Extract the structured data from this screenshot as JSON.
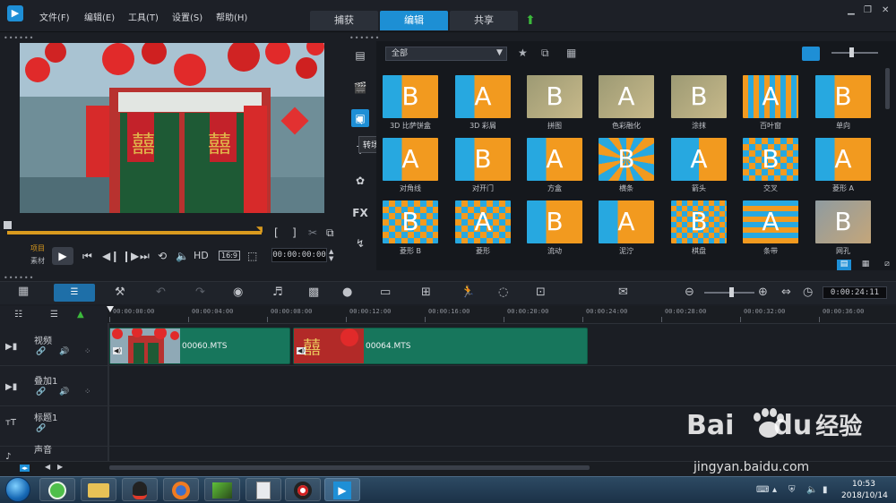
{
  "menu": {
    "file": "文件(F)",
    "edit": "编辑(E)",
    "tools": "工具(T)",
    "settings": "设置(S)",
    "help": "帮助(H)"
  },
  "mode_tabs": {
    "capture": "捕获",
    "edit": "编辑",
    "share": "共享"
  },
  "player": {
    "project_label": "项目",
    "clip_label": "素材",
    "hd_label": "HD",
    "aspect_label": "16:9",
    "timecode": "00:00:00:00"
  },
  "library": {
    "category": "全部",
    "tooltip": "转场",
    "fx_label": "FX",
    "transitions": [
      {
        "label": "3D 比萨饼盒"
      },
      {
        "label": "3D 彩屑"
      },
      {
        "label": "拼图"
      },
      {
        "label": "色彩融化"
      },
      {
        "label": "涂抹"
      },
      {
        "label": "百叶窗"
      },
      {
        "label": "单向"
      },
      {
        "label": "对角线"
      },
      {
        "label": "对开门"
      },
      {
        "label": "方盒"
      },
      {
        "label": "横条"
      },
      {
        "label": "箭头"
      },
      {
        "label": "交叉"
      },
      {
        "label": "菱形 A"
      },
      {
        "label": "菱形 B"
      },
      {
        "label": "菱形"
      },
      {
        "label": "流动"
      },
      {
        "label": "泥泞"
      },
      {
        "label": "棋盘"
      },
      {
        "label": "条带"
      },
      {
        "label": "网孔"
      }
    ]
  },
  "timeline": {
    "duration": "0:00:24:11",
    "ruler_labels": [
      "00:00:00:00",
      "00:00:04:00",
      "00:00:08:00",
      "00:00:12:00",
      "00:00:16:00",
      "00:00:20:00",
      "00:00:24:00",
      "00:00:28:00",
      "00:00:32:00",
      "00:00:36:00"
    ],
    "tracks": {
      "video": "视频",
      "overlay": "叠加1",
      "title": "标题1",
      "voice": "声音"
    },
    "clips": [
      {
        "name": "00060.MTS"
      },
      {
        "name": "00064.MTS"
      }
    ]
  },
  "taskbar": {
    "time": "10:53",
    "date": "2018/10/14"
  },
  "watermark": {
    "brand": "Bai",
    "brand2": "du",
    "cn": "经验",
    "url": "jingyan.baidu.com"
  },
  "colors": {
    "accent": "#1e8fd6",
    "clip": "#17765c",
    "scrub": "#d99a1e",
    "thumb_orange": "#f29a1f",
    "thumb_blue": "#27a8e0"
  }
}
